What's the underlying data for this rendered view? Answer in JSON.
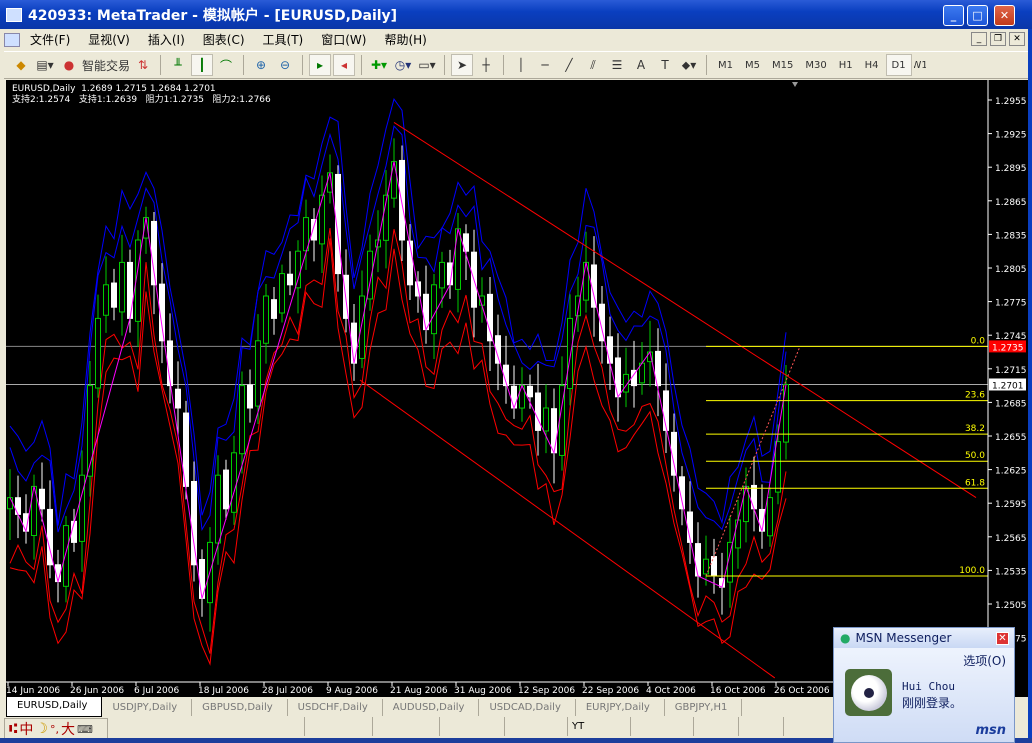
{
  "window": {
    "title": "420933: MetaTrader - 模拟帐户 - [EURUSD,Daily]",
    "minimize": "_",
    "maximize": "□",
    "close": "✕"
  },
  "menu": {
    "items": [
      "文件(F)",
      "显视(V)",
      "插入(I)",
      "图表(C)",
      "工具(T)",
      "窗口(W)",
      "帮助(H)"
    ]
  },
  "toolbar": {
    "expert_label": "智能交易",
    "timeframes": [
      "M1",
      "M5",
      "M15",
      "M30",
      "H1",
      "H4",
      "D1",
      "W1"
    ],
    "active_timeframe": "D1",
    "drawing_labels": {
      "text": "A",
      "label": "T"
    }
  },
  "chart_info": {
    "line1": "EURUSD,Daily  1.2689 1.2715 1.2684 1.2701",
    "line2": "支持2:1.2574   支持1:1.2639   阻力1:1.2735   阻力2:1.2766"
  },
  "chart_data": {
    "type": "candlestick",
    "symbol": "EURUSD",
    "period": "Daily",
    "ylim": [
      1.244,
      1.2985
    ],
    "y_ticks": [
      1.2955,
      1.2925,
      1.2895,
      1.2865,
      1.2835,
      1.2805,
      1.2775,
      1.2745,
      1.2715,
      1.2685,
      1.2655,
      1.2625,
      1.2595,
      1.2565,
      1.2535,
      1.2505,
      1.2475
    ],
    "x_ticks": [
      {
        "bar": 0,
        "label": "14 Jun 2006"
      },
      {
        "bar": 8,
        "label": "26 Jun 2006"
      },
      {
        "bar": 16,
        "label": "6 Jul 2006"
      },
      {
        "bar": 24,
        "label": "18 Jul 2006"
      },
      {
        "bar": 32,
        "label": "28 Jul 2006"
      },
      {
        "bar": 40,
        "label": "9 Aug 2006"
      },
      {
        "bar": 48,
        "label": "21 Aug 2006"
      },
      {
        "bar": 56,
        "label": "31 Aug 2006"
      },
      {
        "bar": 64,
        "label": "12 Sep 2006"
      },
      {
        "bar": 72,
        "label": "22 Sep 2006"
      },
      {
        "bar": 80,
        "label": "4 Oct 2006"
      },
      {
        "bar": 88,
        "label": "16 Oct 2006"
      },
      {
        "bar": 96,
        "label": "26 Oct 2006"
      }
    ],
    "closes": [
      1.26,
      1.2585,
      1.257,
      1.261,
      1.259,
      1.254,
      1.2525,
      1.2575,
      1.256,
      1.262,
      1.27,
      1.276,
      1.279,
      1.277,
      1.281,
      1.276,
      1.283,
      1.285,
      1.279,
      1.274,
      1.27,
      1.268,
      1.261,
      1.254,
      1.251,
      1.256,
      1.262,
      1.259,
      1.264,
      1.27,
      1.268,
      1.274,
      1.278,
      1.276,
      1.28,
      1.279,
      1.282,
      1.285,
      1.283,
      1.287,
      1.289,
      1.28,
      1.276,
      1.272,
      1.278,
      1.282,
      1.283,
      1.287,
      1.29,
      1.283,
      1.279,
      1.278,
      1.275,
      1.279,
      1.281,
      1.279,
      1.284,
      1.282,
      1.277,
      1.278,
      1.274,
      1.272,
      1.27,
      1.268,
      1.27,
      1.269,
      1.266,
      1.268,
      1.264,
      1.27,
      1.276,
      1.278,
      1.281,
      1.277,
      1.274,
      1.272,
      1.269,
      1.271,
      1.27,
      1.272,
      1.273,
      1.27,
      1.266,
      1.262,
      1.259,
      1.256,
      1.253,
      1.2545,
      1.253,
      1.252,
      1.256,
      1.258,
      1.261,
      1.259,
      1.257,
      1.26,
      1.265,
      1.2701
    ],
    "bid_line": 1.2701,
    "ask_line": 1.2735,
    "channel_upper": [
      [
        48,
        1.2935
      ],
      [
        120.75,
        1.26
      ]
    ],
    "channel_lower": [
      [
        43.75,
        1.2705
      ],
      [
        95.6,
        1.2439
      ]
    ],
    "fibo": {
      "start_bar": 87,
      "high": 1.2735,
      "low": 1.253,
      "levels": [
        "0.0",
        "23.6",
        "38.2",
        "50.0",
        "61.8",
        "100.0"
      ]
    },
    "colors": {
      "bull": "#00cc00",
      "bear": "#ffffff",
      "upper_band": "#0000ff",
      "lower_band": "#ff0000",
      "zigzag": "#ff00ff",
      "channel": "#ff0000",
      "fibo": "#ffff00",
      "ask_label_bg": "#ff0000"
    }
  },
  "tabs": [
    "EURUSD,Daily",
    "USDJPY,Daily",
    "GBPUSD,Daily",
    "USDCHF,Daily",
    "AUDUSD,Daily",
    "USDCAD,Daily",
    "EURJPY,Daily",
    "GBPJPY,H1"
  ],
  "status": {
    "profile": "YT"
  },
  "ime": {
    "mode": "中",
    "punct": "°,",
    "width": "大"
  },
  "msn": {
    "title": "MSN Messenger",
    "options": "选项(O)",
    "name": "Hui Chou",
    "message": "刚刚登录。",
    "logo": "msn"
  }
}
